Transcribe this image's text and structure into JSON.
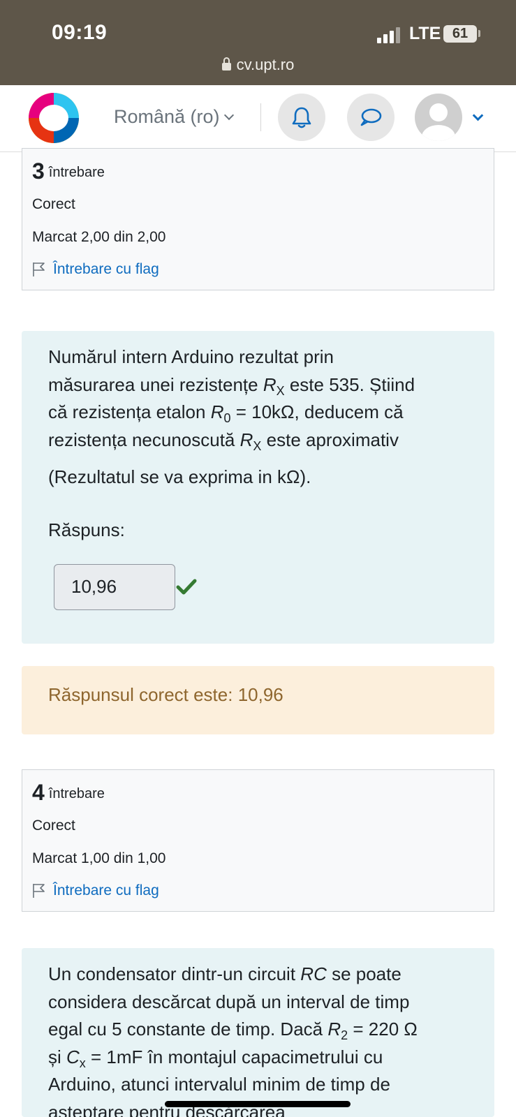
{
  "status_bar": {
    "time": "09:19",
    "network": "LTE",
    "battery": "61",
    "url": "cv.upt.ro"
  },
  "navbar": {
    "language": "Română (ro)",
    "icons": [
      "logo-icon",
      "bell-icon",
      "chat-icon",
      "user-avatar-icon",
      "chevron-down-icon"
    ],
    "accent_color": "#0f6cbf"
  },
  "question3": {
    "number": "3",
    "label": "întrebare",
    "state": "Corect",
    "grade": "Marcat 2,00 din 2,00",
    "flag_label": "Întrebare cu flag",
    "text": {
      "l1": "Numărul intern Arduino rezultat prin",
      "l2a": "măsurarea unei rezistențe ",
      "rx": "R",
      "rx_sub": "X",
      "l2b": " este 535. Știind",
      "l3a": "că rezistența etalon ",
      "r0": "R",
      "r0_sub": "0",
      "l3b": " = 10kΩ, deducem că",
      "l4a": "rezistența necunoscută ",
      "l4b": " este aproximativ",
      "l5": "(Rezultatul se va exprima in kΩ)."
    },
    "answer_label": "Răspuns:",
    "answer_value": "10,96",
    "feedback": "Răspunsul corect este: 10,96"
  },
  "question4": {
    "number": "4",
    "label": "întrebare",
    "state": "Corect",
    "grade": "Marcat 1,00 din 1,00",
    "flag_label": "Întrebare cu flag",
    "text": {
      "l1a": "Un condensator dintr-un circuit ",
      "rc": "RC",
      "l1b": " se poate",
      "l2": "considera descărcat după un interval de timp",
      "l3a": "egal cu 5 constante de timp. Dacă ",
      "r2": "R",
      "r2_sub": "2",
      "l3b": " = 220 Ω",
      "l4a": "și ",
      "cx": "C",
      "cx_sub": "x",
      "l4b": " = 1mF în montajul capacimetrului cu",
      "l5": "Arduino, atunci intervalul minim de timp de",
      "l6": "așteptare pentru descărcarea"
    }
  }
}
